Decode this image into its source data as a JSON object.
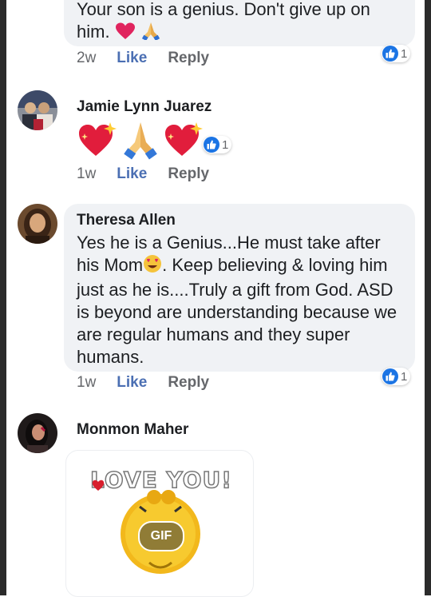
{
  "comments": [
    {
      "text_lines": [
        "Your son is a genius. Don't give up on",
        "him."
      ],
      "time": "2w",
      "like": "Like",
      "reply": "Reply",
      "reactions": "1"
    },
    {
      "author": "Jamie Lynn Juarez",
      "time": "1w",
      "like": "Like",
      "reply": "Reply",
      "reactions": "1"
    },
    {
      "author": "Theresa Allen",
      "text_lines": [
        "Yes he is a Genius...He must take after",
        "his Mom",
        ". Keep believing & loving him",
        "just as he is....Truly a gift from God. ASD",
        "is beyond are understanding because we",
        "are regular humans and they super",
        "humans."
      ],
      "time": "1w",
      "like": "Like",
      "reply": "Reply",
      "reactions": "1"
    },
    {
      "author": "Monmon Maher",
      "gif": {
        "caption": "LOVE YOU!",
        "badge": "GIF"
      }
    }
  ],
  "colors": {
    "like_blue": "#1b74e4",
    "bubble": "#f0f2f5",
    "heart": "#e0245e"
  },
  "icons": [
    "heart-emoji",
    "praying-hands-emoji",
    "sparkling-heart-emoji",
    "heart-eyes-emoji",
    "like-thumb-icon"
  ]
}
